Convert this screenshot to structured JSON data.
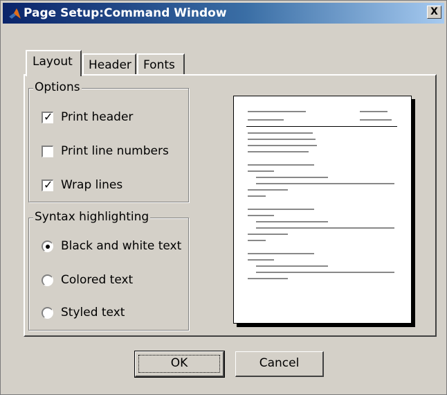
{
  "window": {
    "title": "Page Setup:Command Window",
    "close_label": "X",
    "app_icon": "matlab-logo-icon"
  },
  "tabs": [
    {
      "label": "Layout",
      "active": true
    },
    {
      "label": "Header",
      "active": false
    },
    {
      "label": "Fonts",
      "active": false
    }
  ],
  "options": {
    "group_label": "Options",
    "items": [
      {
        "label": "Print header",
        "checked": true
      },
      {
        "label": "Print line numbers",
        "checked": false
      },
      {
        "label": "Wrap lines",
        "checked": true
      }
    ]
  },
  "syntax": {
    "group_label": "Syntax highlighting",
    "items": [
      {
        "label": "Black and white text",
        "selected": true
      },
      {
        "label": "Colored text",
        "selected": false
      },
      {
        "label": "Styled text",
        "selected": false
      }
    ]
  },
  "buttons": {
    "ok_label": "OK",
    "cancel_label": "Cancel"
  }
}
